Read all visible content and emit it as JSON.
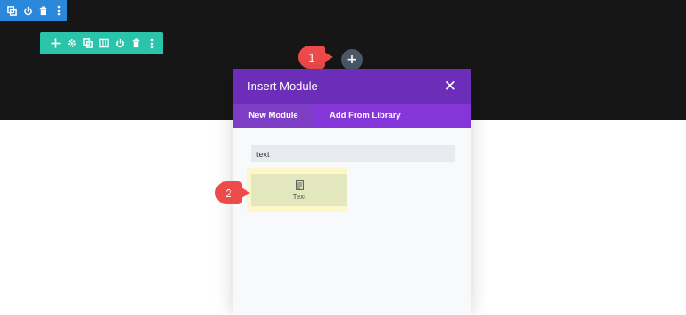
{
  "modal": {
    "title": "Insert Module",
    "close_icon": "close-icon",
    "tabs": [
      {
        "label": "New Module",
        "active": true
      },
      {
        "label": "Add From Library",
        "active": false
      }
    ],
    "search": {
      "value": "text"
    },
    "modules": [
      {
        "label": "Text",
        "icon": "text-module-icon"
      }
    ]
  },
  "callouts": [
    {
      "number": "1"
    },
    {
      "number": "2"
    }
  ],
  "add_module_button": {
    "label": "+"
  },
  "section_toolbar": {
    "color": "#2b87da",
    "icons": [
      "duplicate-icon",
      "power-icon",
      "trash-icon",
      "more-icon"
    ]
  },
  "row_toolbar": {
    "color": "#29c4a9",
    "icons": [
      "move-icon",
      "gear-icon",
      "duplicate-icon",
      "columns-icon",
      "power-icon",
      "trash-icon",
      "more-icon"
    ]
  },
  "colors": {
    "modal_header": "#6c2eb9",
    "tabs_bar": "#8436d9",
    "callout": "#ef4a4a",
    "dark_band": "#161616"
  }
}
